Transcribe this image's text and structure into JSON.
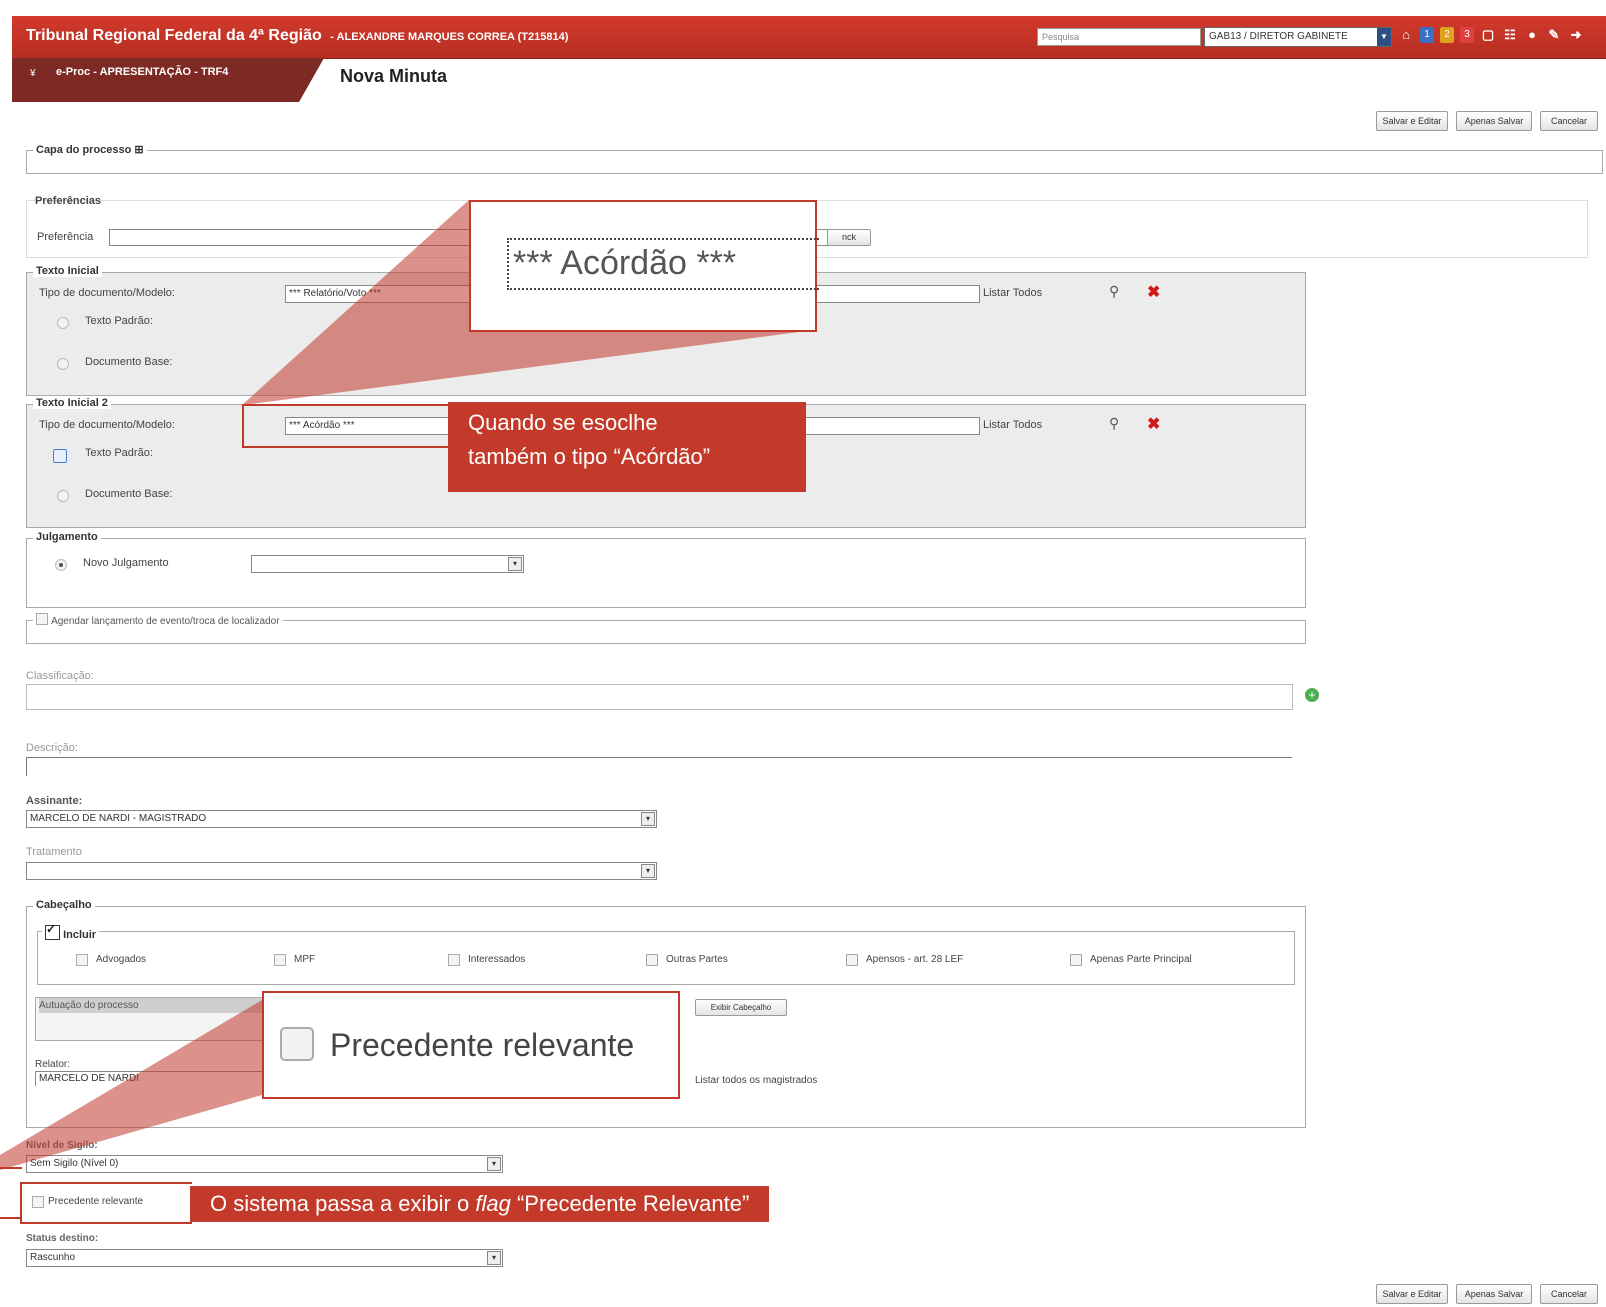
{
  "header": {
    "title": "Tribunal Regional Federal da 4ª Região",
    "user": "- ALEXANDRE MARQUES CORREA (T215814)",
    "search_placeholder": "Pesquisa",
    "profile": "GAB13 / DIRETOR GABINETE",
    "badges": [
      "1",
      "2",
      "3"
    ]
  },
  "module": {
    "label": "e-Proc - APRESENTAÇÃO - TRF4",
    "page_title": "Nova Minuta"
  },
  "actions": {
    "save_edit": "Salvar e Editar",
    "save_only": "Apenas Salvar",
    "cancel": "Cancelar"
  },
  "capa": {
    "legend": "Capa do processo"
  },
  "preferencias": {
    "legend": "Preferências",
    "field_label": "Preferência",
    "button_fragment": "nck"
  },
  "texto_inicial": {
    "legend": "Texto Inicial",
    "tipo_label": "Tipo de documento/Modelo:",
    "tipo_value": "*** Relatório/Voto ***",
    "listar": "Listar Todos",
    "opt_padrao": "Texto Padrão:",
    "opt_base": "Documento Base:"
  },
  "texto_inicial2": {
    "legend": "Texto Inicial 2",
    "tipo_label": "Tipo de documento/Modelo:",
    "tipo_value": "*** Acórdão ***",
    "listar": "Listar Todos",
    "opt_padrao": "Texto Padrão:",
    "opt_base": "Documento Base:"
  },
  "julgamento": {
    "legend": "Julgamento",
    "option": "Novo Julgamento",
    "select_value": ""
  },
  "agendar": {
    "label": "Agendar lançamento de evento/troca de localizador"
  },
  "classificacao": {
    "label": "Classificação:"
  },
  "descricao": {
    "label": "Descrição:"
  },
  "assinante": {
    "label": "Assinante:",
    "value": "MARCELO DE NARDI - MAGISTRADO"
  },
  "tratamento": {
    "label": "Tratamento",
    "value": ""
  },
  "cabecalho": {
    "legend": "Cabeçalho",
    "incluir": "Incluir",
    "options": [
      "Advogados",
      "MPF",
      "Interessados",
      "Outras Partes",
      "Apensos - art. 28 LEF",
      "Apenas Parte Principal"
    ],
    "autuacao": "Autuação do processo",
    "exibir": "Exibir Cabeçalho",
    "relator_label": "Relator:",
    "relator_value": "MARCELO DE NARDI",
    "listar_magistrados": "Listar todos os magistrados"
  },
  "sigilo": {
    "label": "Nível de Sigilo:",
    "value": "Sem Sigilo (Nível 0)"
  },
  "precedente": {
    "label": "Precedente relevante"
  },
  "status": {
    "label": "Status destino:",
    "value": "Rascunho"
  },
  "annotations": {
    "zoom1": "*** Acórdão ***",
    "note1_line1": "Quando se esoclhe",
    "note1_line2": "também o tipo “Acórdão”",
    "zoom2": "Precedente relevante",
    "note2_pre": "O sistema passa a exibir o ",
    "note2_flag": "flag",
    "note2_post": " “Precedente Relevante”"
  },
  "colors": {
    "header_red": "#c0392b",
    "module_tab": "#7d2a25",
    "annotation_red": "#c33a2a"
  }
}
